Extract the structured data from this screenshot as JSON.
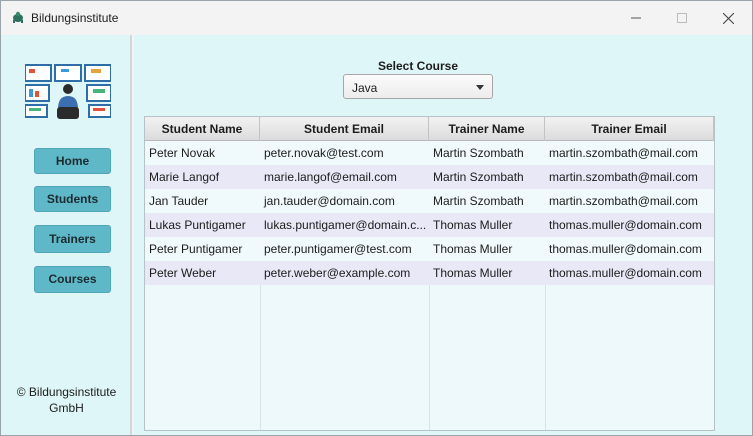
{
  "window": {
    "title": "Bildungsinstitute",
    "icons": {
      "app": "turtle-app-icon",
      "minimize": "minimize-icon",
      "maximize": "maximize-icon",
      "close": "close-icon"
    }
  },
  "sidebar": {
    "logo": "monitoring-workstation-illustration",
    "nav": [
      {
        "label": "Home"
      },
      {
        "label": "Students"
      },
      {
        "label": "Trainers"
      },
      {
        "label": "Courses"
      }
    ],
    "copyright_line1": "© Bildungsinstitute",
    "copyright_line2": "GmbH",
    "accent": "#5fb8c8"
  },
  "main": {
    "select_label": "Select Course",
    "select_value": "Java",
    "table": {
      "columns": [
        "Student Name",
        "Student Email",
        "Trainer Name",
        "Trainer Email"
      ],
      "rows": [
        [
          "Peter Novak",
          "peter.novak@test.com",
          "Martin Szombath",
          "martin.szombath@mail.com"
        ],
        [
          "Marie Langof",
          "marie.langof@email.com",
          "Martin Szombath",
          "martin.szombath@mail.com"
        ],
        [
          "Jan Tauder",
          "jan.tauder@domain.com",
          "Martin Szombath",
          "martin.szombath@mail.com"
        ],
        [
          "Lukas Puntigamer",
          "lukas.puntigamer@domain.c...",
          "Thomas Muller",
          "thomas.muller@domain.com"
        ],
        [
          "Peter Puntigamer",
          "peter.puntigamer@test.com",
          "Thomas Muller",
          "thomas.muller@domain.com"
        ],
        [
          "Peter Weber",
          "peter.weber@example.com",
          "Thomas Muller",
          "thomas.muller@domain.com"
        ]
      ]
    },
    "background": "#dff6f8"
  }
}
